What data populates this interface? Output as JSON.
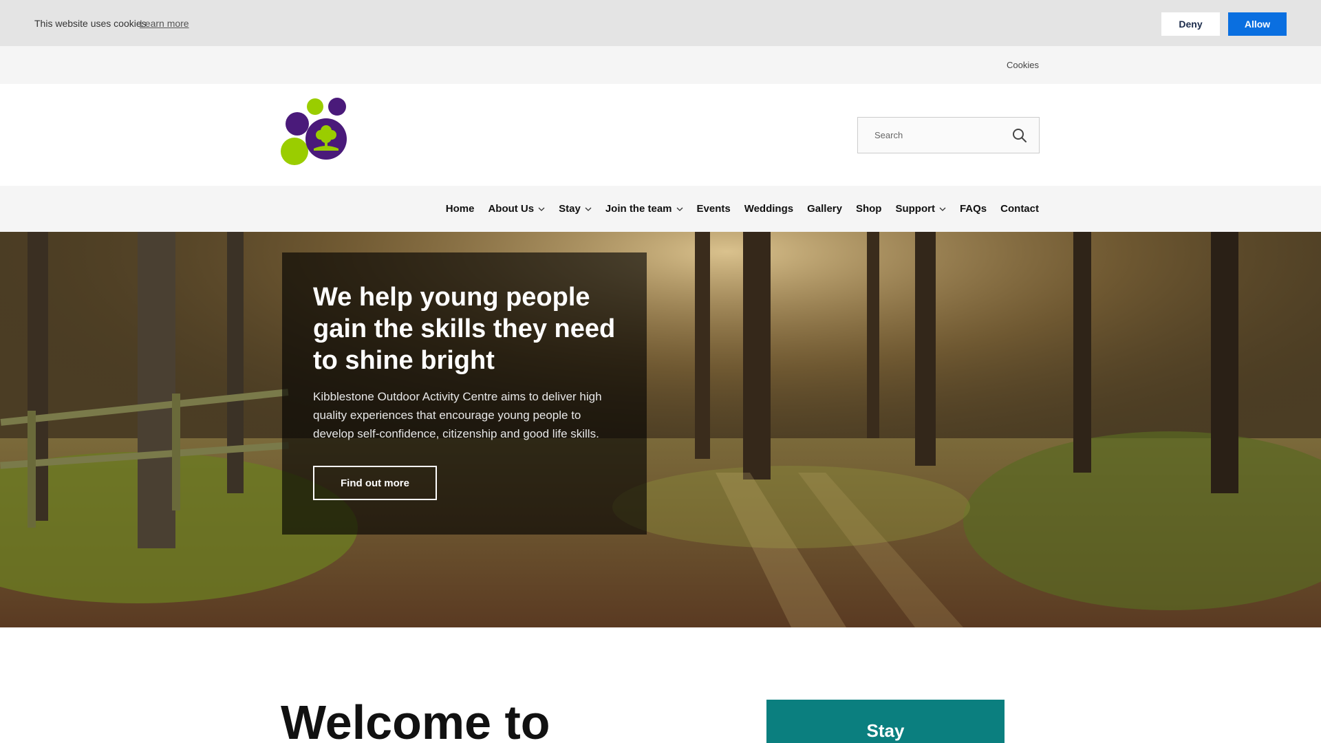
{
  "cookie_bar": {
    "message": "This website uses cookies",
    "learn_more": "Learn more",
    "deny_label": "Deny",
    "allow_label": "Allow"
  },
  "utility_bar": {
    "cookies_link": "Cookies"
  },
  "header": {
    "logo_icon": "tree-paw-logo",
    "search": {
      "placeholder": "Search",
      "icon": "search-icon"
    }
  },
  "nav": {
    "items": [
      {
        "label": "Home",
        "dropdown": false
      },
      {
        "label": "About Us",
        "dropdown": true
      },
      {
        "label": "Stay",
        "dropdown": true
      },
      {
        "label": "Join the team",
        "dropdown": true
      },
      {
        "label": "Events",
        "dropdown": false
      },
      {
        "label": "Weddings",
        "dropdown": false
      },
      {
        "label": "Gallery",
        "dropdown": false
      },
      {
        "label": "Shop",
        "dropdown": false
      },
      {
        "label": "Support",
        "dropdown": true
      },
      {
        "label": "FAQs",
        "dropdown": false
      },
      {
        "label": "Contact",
        "dropdown": false
      }
    ]
  },
  "hero": {
    "title": "We help young people gain the skills they need to shine bright",
    "text": "Kibblestone Outdoor Activity Centre aims to deliver high quality experiences that encourage young people to develop self-confidence, citizenship and good life skills.",
    "button_label": "Find out more"
  },
  "main": {
    "welcome_heading": "Welcome to",
    "stay_card_label": "Stay"
  },
  "colors": {
    "allow_button": "#0a6fe0",
    "logo_purple": "#4a1a7a",
    "logo_green": "#9acd00",
    "stay_card": "#0b7f7f"
  }
}
